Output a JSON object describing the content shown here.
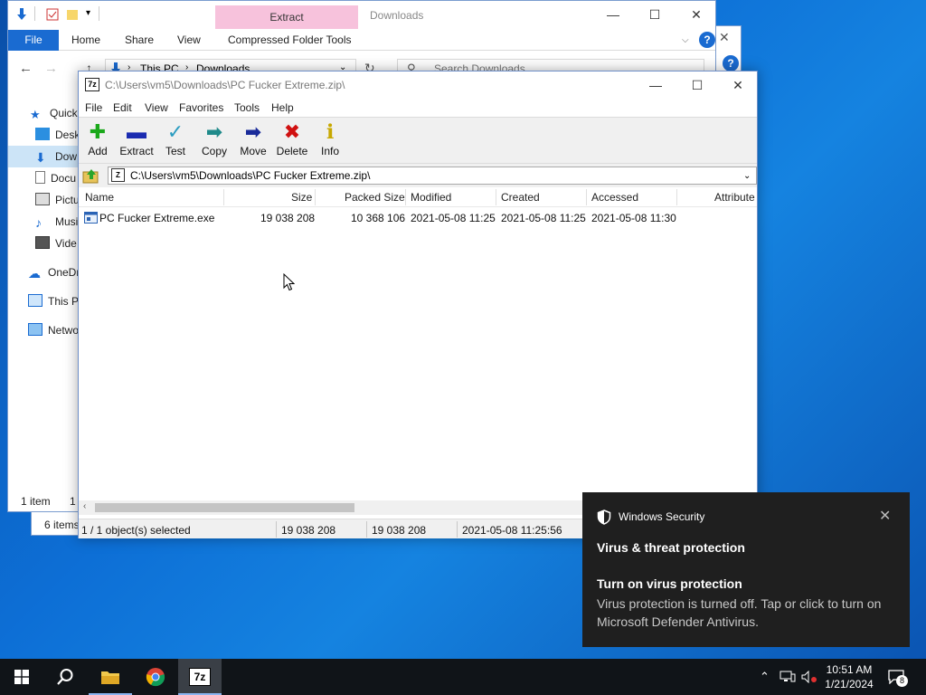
{
  "explorer": {
    "title": "Downloads",
    "context_tab": "Extract",
    "tabs": [
      "File",
      "Home",
      "Share",
      "View",
      "Compressed Folder Tools"
    ],
    "breadcrumb": [
      "This PC",
      "Downloads"
    ],
    "search_placeholder": "Search Downloads",
    "sidebar": [
      "Quick",
      "Desk",
      "Dow",
      "Docu",
      "Pictu",
      "Musi",
      "Vide",
      "OneDr",
      "This P",
      "Netwo"
    ],
    "status_front": "1 item",
    "status_front2": "1",
    "status_back": "6 items"
  },
  "zip": {
    "title": "C:\\Users\\vm5\\Downloads\\PC Fucker Extreme.zip\\",
    "menu": [
      "File",
      "Edit",
      "View",
      "Favorites",
      "Tools",
      "Help"
    ],
    "tools": [
      {
        "label": "Add",
        "icon": "plus-icon",
        "color": "#1aa81a"
      },
      {
        "label": "Extract",
        "icon": "minus-icon",
        "color": "#1a2bb0"
      },
      {
        "label": "Test",
        "icon": "check-icon",
        "color": "#2a9cc0"
      },
      {
        "label": "Copy",
        "icon": "copy-arrow-icon",
        "color": "#1f8a8a"
      },
      {
        "label": "Move",
        "icon": "move-arrow-icon",
        "color": "#1a2b9a"
      },
      {
        "label": "Delete",
        "icon": "x-icon",
        "color": "#d01010"
      },
      {
        "label": "Info",
        "icon": "info-icon",
        "color": "#c7a800"
      }
    ],
    "path": "C:\\Users\\vm5\\Downloads\\PC Fucker Extreme.zip\\",
    "columns": [
      "Name",
      "Size",
      "Packed Size",
      "Modified",
      "Created",
      "Accessed",
      "Attribute"
    ],
    "rows": [
      {
        "name": "PC Fucker Extreme.exe",
        "size": "19 038 208",
        "packed": "10 368 106",
        "modified": "2021-05-08 11:25",
        "created": "2021-05-08 11:25",
        "accessed": "2021-05-08 11:30"
      }
    ],
    "status": {
      "selected": "1 / 1 object(s) selected",
      "size": "19 038 208",
      "packed": "19 038 208",
      "date": "2021-05-08 11:25:56"
    }
  },
  "toast": {
    "app": "Windows Security",
    "heading": "Virus & threat protection",
    "subheading": "Turn on virus protection",
    "body": "Virus protection is turned off. Tap or click to turn on Microsoft Defender Antivirus."
  },
  "taskbar": {
    "time": "10:51 AM",
    "date": "1/21/2024",
    "notifications": "8"
  }
}
